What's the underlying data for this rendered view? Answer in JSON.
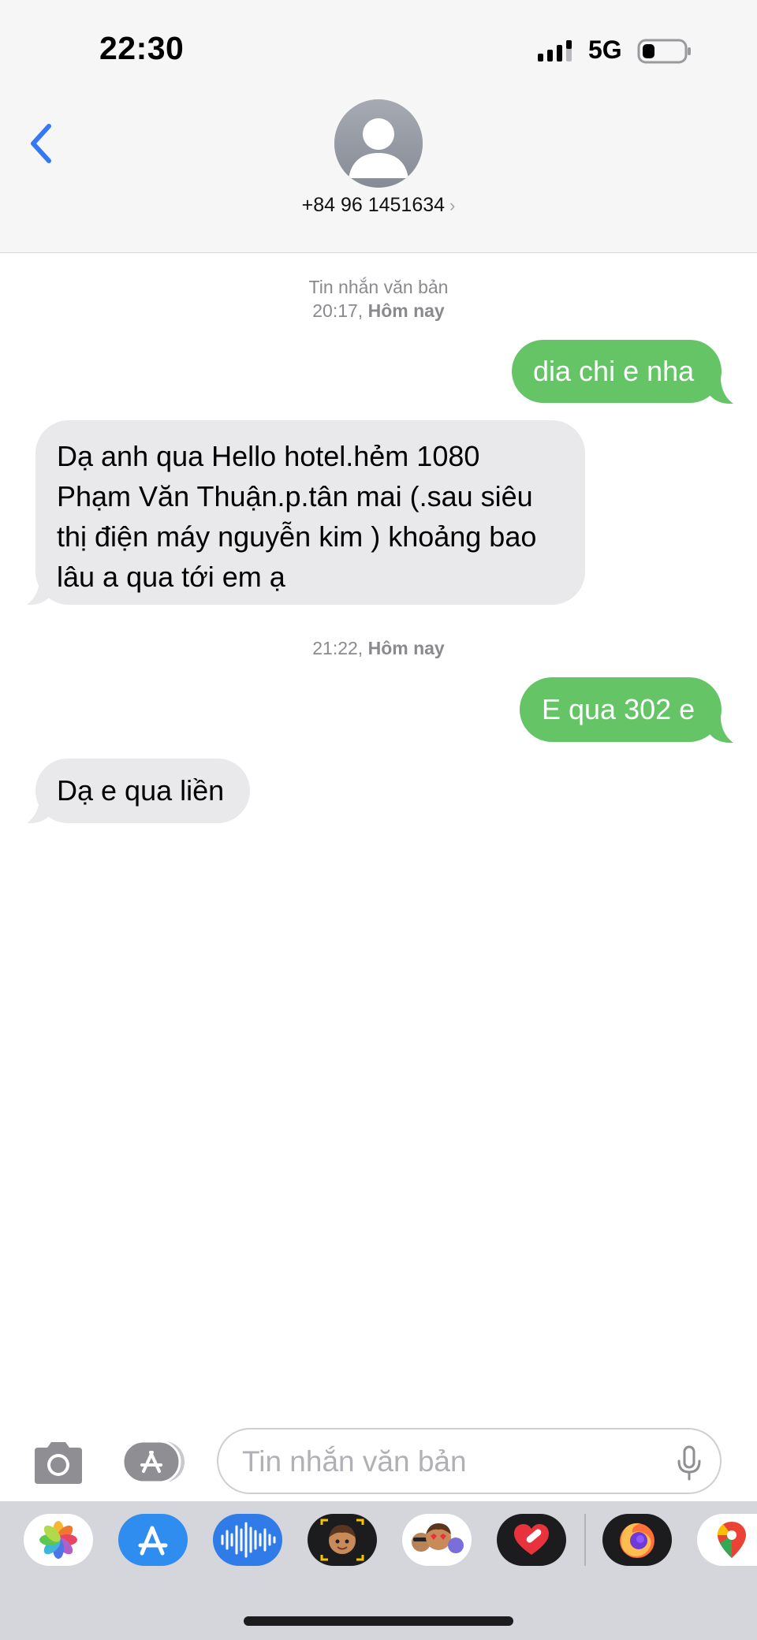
{
  "status_bar": {
    "time": "22:30",
    "network": "5G"
  },
  "header": {
    "contact": "+84 96 1451634",
    "contact_chevron": "›"
  },
  "conversation": [
    {
      "type": "timestamp",
      "line1": "Tin nhắn văn bản",
      "line2_time": "20:17,",
      "line2_day": "Hôm nay"
    },
    {
      "type": "sent",
      "text": "dia chi e nha"
    },
    {
      "type": "received",
      "lines": [
        "Dạ anh qua Hello hotel.hẻm 1080",
        "Phạm Văn Thuận.p.tân mai (.sau siêu",
        "thị điện máy nguyễn kim ) khoảng bao",
        "lâu a qua tới em ạ"
      ]
    },
    {
      "type": "timestamp",
      "line2_time": "21:22,",
      "line2_day": "Hôm nay"
    },
    {
      "type": "sent",
      "text": "E qua 302 e"
    },
    {
      "type": "received",
      "text": "Dạ e qua liền"
    }
  ],
  "input": {
    "placeholder": "Tin nhắn văn bản"
  },
  "icons": {
    "back": "chevron-left-icon",
    "camera": "camera-icon",
    "apps": "app-store-icon",
    "mic": "microphone-icon",
    "avatar": "person-icon"
  },
  "drawer_apps": [
    "photos",
    "app-store",
    "audio-message",
    "memoji",
    "animoji-stickers",
    "digital-touch",
    "firefox",
    "google-maps"
  ],
  "colors": {
    "sent_bubble": "#65c466",
    "received_bubble": "#e9e9eb",
    "accent": "#3478f6",
    "header_bg": "#f6f6f6"
  }
}
